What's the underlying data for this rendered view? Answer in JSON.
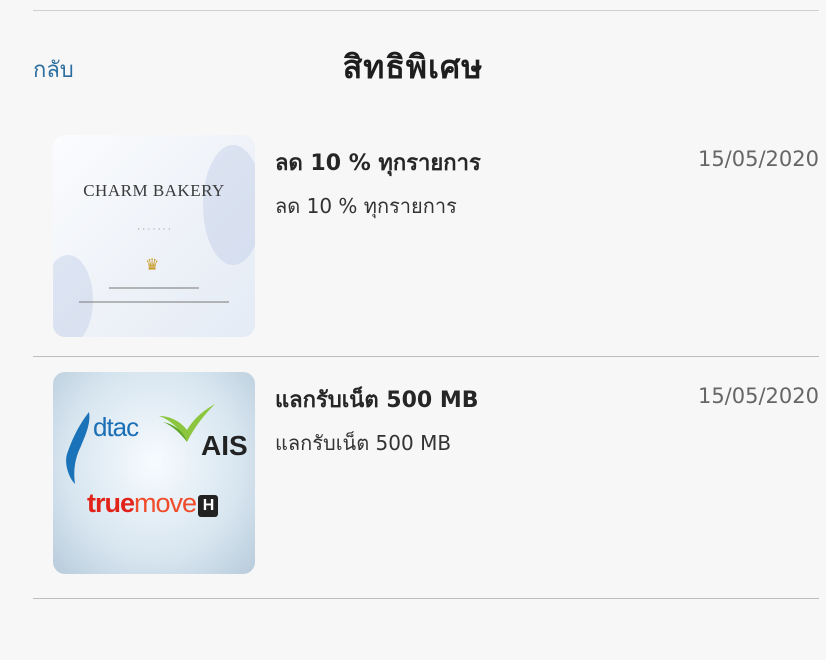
{
  "header": {
    "back_label": "กลับ",
    "title": "สิทธิพิเศษ"
  },
  "privileges": [
    {
      "title": "ลด 10 % ทุกรายการ",
      "subtitle": "ลด 10 % ทุกรายการ",
      "date": "15/05/2020",
      "image": {
        "type": "bakery-logo",
        "name": "CHARM BAKERY"
      }
    },
    {
      "title": "แลกรับเน็ต 500 MB",
      "subtitle": "แลกรับเน็ต 500 MB",
      "date": "15/05/2020",
      "image": {
        "type": "telecom-logos",
        "dtac": "dtac",
        "ais": "AIS",
        "truemove_a": "true",
        "truemove_b": "move",
        "truemove_h": "H"
      }
    }
  ],
  "colors": {
    "background": "#f7f7f7",
    "back_link": "#2c6fa0",
    "divider": "#bdbdbd",
    "dtac_blue": "#1a6fb5",
    "true_red": "#e2231a"
  }
}
